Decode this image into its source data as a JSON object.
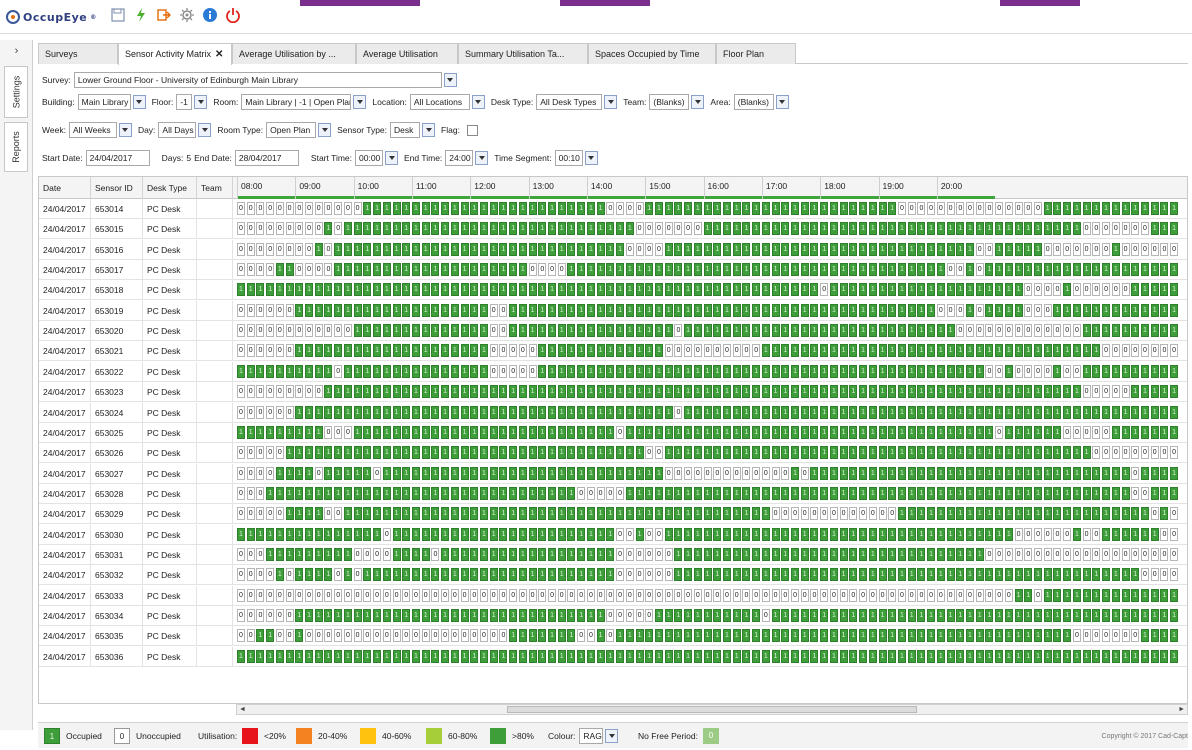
{
  "app": {
    "logo_text": "OccupEye",
    "logo_mark": "®",
    "toolbar_icons": [
      "save-icon",
      "refresh-icon",
      "export-icon",
      "settings-icon",
      "info-icon",
      "power-icon"
    ]
  },
  "side_tabs": [
    "Settings",
    "Reports"
  ],
  "tabs": [
    {
      "label": "Surveys",
      "active": false,
      "closable": false
    },
    {
      "label": "Sensor Activity Matrix",
      "active": true,
      "closable": true
    },
    {
      "label": "Average Utilisation by ...",
      "active": false,
      "closable": false
    },
    {
      "label": "Average Utilisation",
      "active": false,
      "closable": false
    },
    {
      "label": "Summary Utilisation Ta...",
      "active": false,
      "closable": false
    },
    {
      "label": "Spaces Occupied by Time",
      "active": false,
      "closable": false
    },
    {
      "label": "Floor Plan",
      "active": false,
      "closable": false
    }
  ],
  "filters": {
    "survey_label": "Survey:",
    "survey_value": "Lower Ground Floor - University of Edinburgh Main Library",
    "building_label": "Building:",
    "building_value": "Main Library",
    "floor_label": "Floor:",
    "floor_value": "-1",
    "room_label": "Room:",
    "room_value": "Main Library | -1 | Open Plan",
    "location_label": "Location:",
    "location_value": "All Locations",
    "desk_type_label": "Desk Type:",
    "desk_type_value": "All Desk Types",
    "team_label": "Team:",
    "team_value": "(Blanks)",
    "area_label": "Area:",
    "area_value": "(Blanks)",
    "week_label": "Week:",
    "week_value": "All Weeks",
    "day_label": "Day:",
    "day_value": "All Days",
    "room_type_label": "Room Type:",
    "room_type_value": "Open Plan",
    "sensor_type_label": "Sensor Type:",
    "sensor_type_value": "Desk",
    "flag_label": "Flag:",
    "start_date_label": "Start Date:",
    "start_date_value": "24/04/2017",
    "days_label": "Days:",
    "days_value": "5",
    "end_date_label": "End Date:",
    "end_date_value": "28/04/2017",
    "start_time_label": "Start Time:",
    "start_time_value": "00:00",
    "end_time_label": "End Time:",
    "end_time_value": "24:00",
    "time_segment_label": "Time Segment:",
    "time_segment_value": "00:10"
  },
  "matrix": {
    "columns": [
      "Date",
      "Sensor ID",
      "Desk Type",
      "Team"
    ],
    "hours": [
      "08:00",
      "09:00",
      "10:00",
      "11:00",
      "12:00",
      "13:00",
      "14:00",
      "15:00",
      "16:00",
      "17:00",
      "18:00",
      "19:00",
      "20:00"
    ],
    "rows": [
      {
        "date": "24/04/2017",
        "sensor_id": "653014",
        "desk_type": "PC Desk",
        "team": "",
        "slots": "00000000000001111111111111111111111111000011111111111111111111111111000000000000000111111111111111111"
      },
      {
        "date": "24/04/2017",
        "sensor_id": "653015",
        "desk_type": "PC Desk",
        "team": "",
        "slots": "00000000010111111111111111111111111111111000000011111111111111111111111111111111111111100000001111111"
      },
      {
        "date": "24/04/2017",
        "sensor_id": "653016",
        "desk_type": "PC Desk",
        "team": "",
        "slots": "00000000101111111111111111111111111111110000111111111111111111111111111111110011111000000010000000111"
      },
      {
        "date": "24/04/2017",
        "sensor_id": "653017",
        "desk_type": "PC Desk",
        "team": "",
        "slots": "00001100001111111111111111111100001111111111111111111111111111111111111110010111111111111111111110011"
      },
      {
        "date": "24/04/2017",
        "sensor_id": "653018",
        "desk_type": "PC Desk",
        "team": "",
        "slots": "11111111111111111111111111111111111111111111111111111111111101111111111111111111100001000000111111111"
      },
      {
        "date": "24/04/2017",
        "sensor_id": "653019",
        "desk_type": "PC Desk",
        "team": "",
        "slots": "00000011111111111111111111001111111111111111111111111111111111111111111100010111100011111111111111111"
      },
      {
        "date": "24/04/2017",
        "sensor_id": "653020",
        "desk_type": "PC Desk",
        "team": "",
        "slots": "00000000000011111111111111001111111111111111101111111111111111111111111111000000000000011111111110000"
      },
      {
        "date": "24/04/2017",
        "sensor_id": "653021",
        "desk_type": "PC Desk",
        "team": "",
        "slots": "00000011111111111111111111000001111111111111000000000011111111111111111111111111111111111000000000000"
      },
      {
        "date": "24/04/2017",
        "sensor_id": "653022",
        "desk_type": "PC Desk",
        "team": "",
        "slots": "11111111110111111111111111000001111111111111111111111111111111111111111111111001000010011111111111111"
      },
      {
        "date": "24/04/2017",
        "sensor_id": "653023",
        "desk_type": "PC Desk",
        "team": "",
        "slots": "00000000011111111111111111111111111111111111111111111111111111111111111111111111111111100000111111111"
      },
      {
        "date": "24/04/2017",
        "sensor_id": "653024",
        "desk_type": "PC Desk",
        "team": "",
        "slots": "00000011111111111111111111111111111111111111101111111111111111111111111111111111111111111111111111111"
      },
      {
        "date": "24/04/2017",
        "sensor_id": "653025",
        "desk_type": "PC Desk",
        "team": "",
        "slots": "11111111100011111111111111111111111111101111111111111111111111111111111111111101111110000011111111111"
      },
      {
        "date": "24/04/2017",
        "sensor_id": "653026",
        "desk_type": "PC Desk",
        "team": "",
        "slots": "00000111111111111111111111111111111111111100111111111111111111111111111111111111111111110000000001000000"
      },
      {
        "date": "24/04/2017",
        "sensor_id": "653027",
        "desk_type": "PC Desk",
        "team": "",
        "slots": "00001111011111011111111111111111111111111111000000000000010111111111111111111111111111111111011110000"
      },
      {
        "date": "24/04/2017",
        "sensor_id": "653028",
        "desk_type": "PC Desk",
        "team": "",
        "slots": "00011111111111111111111111111111111000001111111111111111111111111111111111111111111111111111001111111"
      },
      {
        "date": "24/04/2017",
        "sensor_id": "653029",
        "desk_type": "PC Desk",
        "team": "",
        "slots": "00000111100111111111111111111111111111111111111111111110000000000000111111111111111111111111110100111"
      },
      {
        "date": "24/04/2017",
        "sensor_id": "653030",
        "desk_type": "PC Desk",
        "team": "",
        "slots": "11111111111111101111111111111111111111100100111111111111111111111111111111111111000000100111111000000"
      },
      {
        "date": "24/04/2017",
        "sensor_id": "653031",
        "desk_type": "PC Desk",
        "team": "",
        "slots": "00011111111100001111011111111111111111100000011111111111111111111111111111111000000000000000000000000001"
      },
      {
        "date": "24/04/2017",
        "sensor_id": "653032",
        "desk_type": "PC Desk",
        "team": "",
        "slots": "00001011110101111111111111111111111111100000011111111111111111111111111111111111111111111111100000000"
      },
      {
        "date": "24/04/2017",
        "sensor_id": "653033",
        "desk_type": "PC Desk",
        "team": "",
        "slots": "00000000000000000000000000000000000000000000000000000000000000000000000000000000110111111111111111111"
      },
      {
        "date": "24/04/2017",
        "sensor_id": "653034",
        "desk_type": "PC Desk",
        "team": "",
        "slots": "00000011111111111111111111111111111111000001111111111101111111111111111111111111111111111111111111111"
      },
      {
        "date": "24/04/2017",
        "sensor_id": "653035",
        "desk_type": "PC Desk",
        "team": "",
        "slots": "00110010000000000000000000001111111001011111111111111111111111111111111111111111111111000000011111111"
      },
      {
        "date": "24/04/2017",
        "sensor_id": "653036",
        "desk_type": "PC Desk",
        "team": "",
        "slots": "11111111111111111111111111111111111111111111111111111111111111111111111111111111111111111111111111111"
      }
    ]
  },
  "legend": {
    "occupied_value": "1",
    "occupied_label": "Occupied",
    "unoccupied_value": "0",
    "unoccupied_label": "Unoccupied",
    "utilisation_label": "Utilisation:",
    "bands": [
      {
        "label": "<20%",
        "color": "#e8141b"
      },
      {
        "label": "20-40%",
        "color": "#f58220"
      },
      {
        "label": "40-60%",
        "color": "#ffc20e"
      },
      {
        "label": "60-80%",
        "color": "#a6ce39"
      },
      {
        "label": ">80%",
        "color": "#3e9e3a"
      }
    ],
    "colour_label": "Colour:",
    "colour_value": "RAG",
    "no_free_period_label": "No Free Period:",
    "no_free_period_value": "0",
    "copyright": "Copyright © 2017 Cad-Capt"
  },
  "colors": {
    "occupied": "#3e9e3a",
    "accent": "#7a2e8e",
    "brand": "#2f3f7f"
  }
}
